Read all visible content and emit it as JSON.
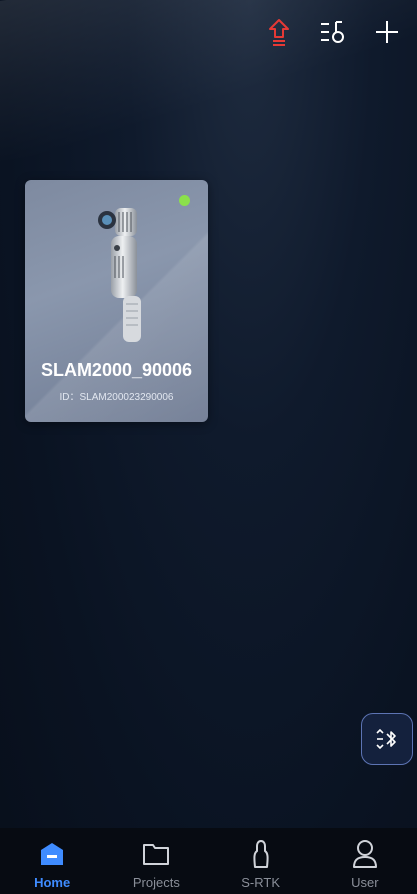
{
  "topbar": {
    "upload_icon": "upload-arrow-icon",
    "filter_icon": "list-sort-icon",
    "add_icon": "plus-icon",
    "upload_color": "#e53935"
  },
  "device_card": {
    "name": "SLAM2000_90006",
    "id_text": "ID：SLAM200023290006",
    "status_color": "#8be04b"
  },
  "floating_button": {
    "icon": "bluetooth-icon"
  },
  "tabs": [
    {
      "label": "Home",
      "icon": "home-icon",
      "active": true
    },
    {
      "label": "Projects",
      "icon": "folder-icon",
      "active": false
    },
    {
      "label": "S-RTK",
      "icon": "rtk-receiver-icon",
      "active": false
    },
    {
      "label": "User",
      "icon": "user-icon",
      "active": false
    }
  ],
  "colors": {
    "accent": "#3f8cff",
    "tab_inactive": "#8a8f99"
  }
}
